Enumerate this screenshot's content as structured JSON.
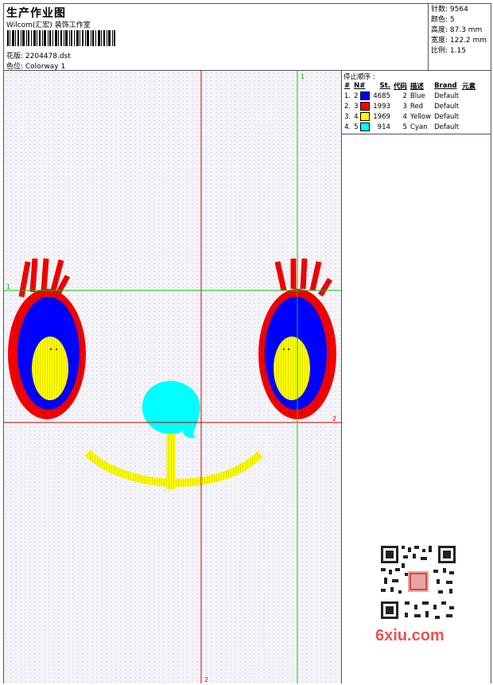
{
  "header": {
    "title": "生产作业图",
    "subtitle": "Wilcom(汇宏) 装饰工作室",
    "pattern_label": "花版: 2204478.dst",
    "colorway_label": "色位: Colorway 1"
  },
  "stats": {
    "stitches": "针数: 9564",
    "colors": "颜色: 5",
    "height": "高度: 87.3 mm",
    "width": "宽度: 122.2 mm",
    "scale": "比例: 1.15"
  },
  "stop_sequence": {
    "title": "停止顺序 :",
    "headers": [
      "#",
      "N#",
      "St.",
      "代码",
      "描述",
      "Brand",
      "元素"
    ],
    "rows": [
      {
        "idx": "1.",
        "n": "2",
        "st": "4685",
        "code": "2",
        "desc": "Blue",
        "brand": "Default",
        "color": "#0000ff"
      },
      {
        "idx": "2.",
        "n": "3",
        "st": "1993",
        "code": "3",
        "desc": "Red",
        "brand": "Default",
        "color": "#ff0000"
      },
      {
        "idx": "3.",
        "n": "4",
        "st": "1969",
        "code": "4",
        "desc": "Yellow",
        "brand": "Default",
        "color": "#ffff00"
      },
      {
        "idx": "4.",
        "n": "5",
        "st": "914",
        "code": "5",
        "desc": "Cyan",
        "brand": "Default",
        "color": "#00ffff"
      }
    ]
  },
  "guides": {
    "green_v": "1",
    "green_h": "1",
    "red_h": "2",
    "red_v": "2"
  },
  "watermark": "6xiu.com",
  "colors": {
    "blue": "#0000ff",
    "red": "#ff0000",
    "yellow": "#ffff00",
    "cyan": "#00ffff",
    "guide_green": "#00cc00",
    "guide_red": "#dd0000"
  }
}
